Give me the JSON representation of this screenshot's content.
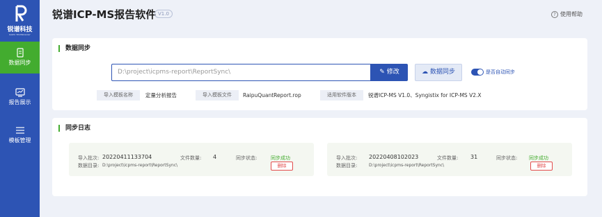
{
  "brand": {
    "name_cn": "锐谱科技",
    "name_en": "RAIPU TECHNOLOGY"
  },
  "sidebar": {
    "items": [
      {
        "label": "数据同步",
        "icon": "document-sync-icon",
        "active": true
      },
      {
        "label": "报告展示",
        "icon": "report-display-icon",
        "active": false
      },
      {
        "label": "模板管理",
        "icon": "template-list-icon",
        "active": false
      }
    ]
  },
  "header": {
    "title": "锐谱ICP-MS报告软件",
    "version": "V1.0",
    "help": "使用帮助"
  },
  "sync": {
    "title": "数据同步",
    "path": "D:\\project\\icpms-report\\ReportSync\\",
    "edit_label": "修改",
    "sync_label": "数据同步",
    "auto_sync_label": "是否自动同步",
    "auto_sync_on": true,
    "template_name_label": "导入模板名称",
    "template_name": "定量分析报告",
    "template_file_label": "导入模板文件",
    "template_file": "RaipuQuantReport.rop",
    "software_version_label": "适用软件版本",
    "software_version": "锐谱ICP-MS V1.0、Syngistix for ICP-MS V2.X"
  },
  "log": {
    "title": "同步日志",
    "entries": [
      {
        "batch_label": "导入批次:",
        "batch": "20220411133704",
        "count_label": "文件数量:",
        "count": "4",
        "status_label": "同步状态:",
        "status": "同步成功",
        "dir_label": "数据目录:",
        "dir": "D:\\project\\icpms-report\\ReportSync\\",
        "delete_label": "删除"
      },
      {
        "batch_label": "导入批次:",
        "batch": "20220408102023",
        "count_label": "文件数量:",
        "count": "31",
        "status_label": "同步状态:",
        "status": "同步成功",
        "dir_label": "数据目录:",
        "dir": "D:\\project\\icpms-report\\ReportSync\\",
        "delete_label": "删除"
      }
    ]
  },
  "colors": {
    "sidebar": "#2d54b4",
    "active": "#43ac2f",
    "accent": "#2d54b4",
    "danger": "#e24b4b",
    "success": "#43ac2f"
  }
}
